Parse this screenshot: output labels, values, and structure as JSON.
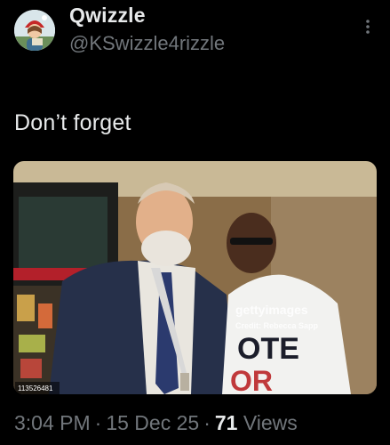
{
  "author": {
    "display_name": "Qwizzle",
    "handle": "@KSwizzle4rizzle",
    "avatar_icon": "avatar-icon"
  },
  "menu": {
    "icon": "more-vertical-icon"
  },
  "tweet": {
    "text": "Don’t forget"
  },
  "media": {
    "watermark": "gettyimages",
    "credit": "Credit: Rebecca Sapp",
    "image_id": "113526481",
    "shirt_text_line1": "OTE",
    "shirt_text_line2": "OR"
  },
  "meta": {
    "time": "3:04 PM",
    "separator": "·",
    "date": "15 Dec 25",
    "views_count": "71",
    "views_label": "Views"
  },
  "colors": {
    "background": "#000000",
    "primary_text": "#e7e9ea",
    "secondary_text": "#71767b"
  }
}
